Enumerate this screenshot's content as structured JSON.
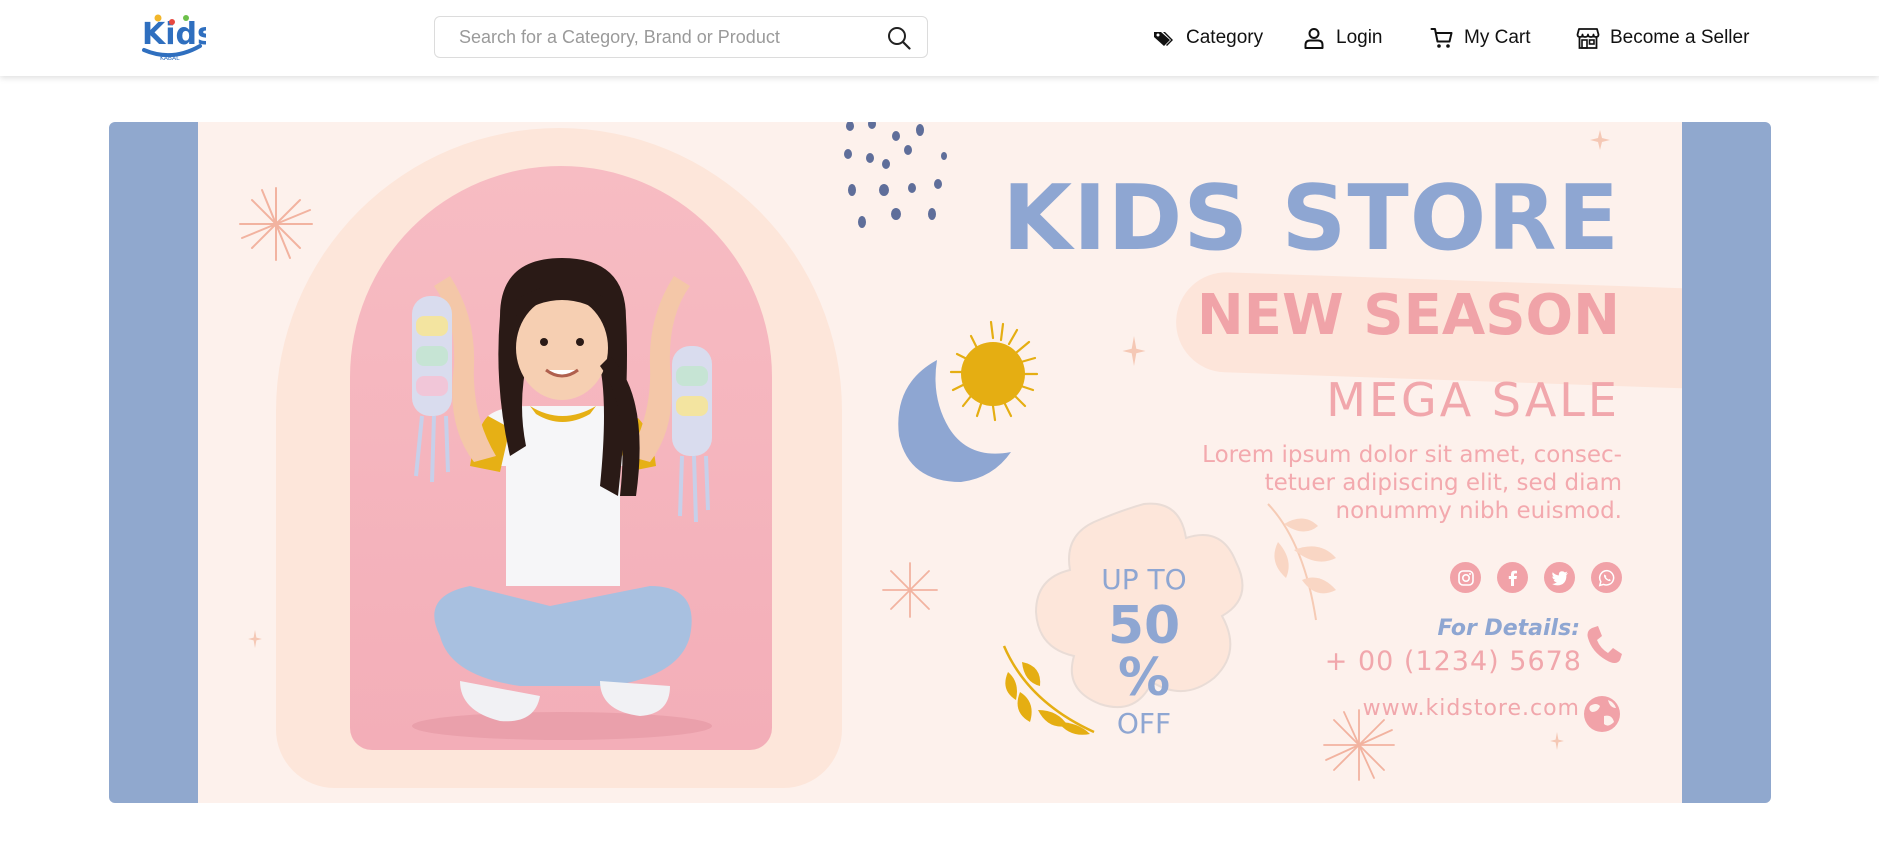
{
  "header": {
    "logo": {
      "text": "Kids",
      "subtext": "KABAL"
    },
    "search": {
      "placeholder": "Search for a Category, Brand or Product"
    },
    "nav": {
      "category": "Category",
      "login": "Login",
      "cart": "My Cart",
      "seller": "Become a Seller"
    }
  },
  "banner": {
    "title": "KIDS STORE",
    "subtitle": "NEW SEASON",
    "tagline": "MEGA SALE",
    "description": "Lorem ipsum dolor sit amet, consec-tetuer adipiscing elit, sed diam nonummy nibh euismod.",
    "offer": {
      "line1": "UP TO",
      "line2": "50 %",
      "line3": "OFF"
    },
    "contact": {
      "label": "For Details:",
      "phone": "+ 00 (1234) 5678",
      "website": "www.kidstore.com"
    },
    "social_icons": [
      "instagram-icon",
      "facebook-icon",
      "twitter-icon",
      "whatsapp-icon"
    ]
  },
  "colors": {
    "banner_side": "#90a8ce",
    "banner_bg": "#fdf1ec",
    "blue_text": "#8ea6d2",
    "pink_text": "#f0a3a8",
    "sun": "#e5ae12"
  }
}
